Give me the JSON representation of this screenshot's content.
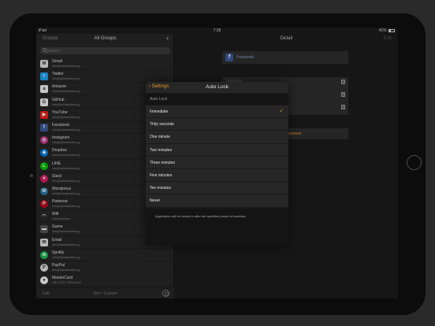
{
  "status_bar": {
    "device": "iPad",
    "time": "7:35",
    "battery": "41%"
  },
  "master": {
    "nav": {
      "left": "Groups",
      "title": "All Groups",
      "add": "+"
    },
    "search": {
      "placeholder": "Search"
    },
    "items": [
      {
        "name": "Gmail",
        "account": "info@kaihatsutetsu.jp",
        "icon": "gmail-icon",
        "color": "#e0e0e0",
        "glyph": "M"
      },
      {
        "name": "Twitter",
        "account": "info@kaihatsutetsu.jp",
        "icon": "twitter-icon",
        "color": "#1da1f2",
        "glyph": "t"
      },
      {
        "name": "Amazon",
        "account": "info@kaihatsutetsu.jp",
        "icon": "amazon-icon",
        "color": "#f2f2f2",
        "glyph": "a"
      },
      {
        "name": "GitHub",
        "account": "info@kaihatsutetsu.jp",
        "icon": "github-icon",
        "color": "#f2f2f2",
        "glyph": "G"
      },
      {
        "name": "YouTube",
        "account": "info@kaihatsutetsu.jp",
        "icon": "youtube-icon",
        "color": "#e62117",
        "glyph": "▶"
      },
      {
        "name": "Facebook",
        "account": "info@kaihatsutetsu.jp",
        "icon": "facebook-icon",
        "color": "#3b5998",
        "glyph": "f"
      },
      {
        "name": "Instagram",
        "account": "info@kaihatsutetsu.jp",
        "icon": "instagram-icon",
        "color": "#c13584",
        "glyph": "◎"
      },
      {
        "name": "Dropbox",
        "account": "info@kaihatsutetsu.jp",
        "icon": "dropbox-icon",
        "color": "#007ee5",
        "glyph": "◆"
      },
      {
        "name": "LINE",
        "account": "info@kaihatsutetsu.jp",
        "icon": "line-icon",
        "color": "#00c300",
        "glyph": "L"
      },
      {
        "name": "Slack",
        "account": "info@kaihatsutetsu.jp",
        "icon": "slack-icon",
        "color": "#d81b60",
        "glyph": "#"
      },
      {
        "name": "Wordpress",
        "account": "info@kaihatsutetsu.jp",
        "icon": "wordpress-icon",
        "color": "#21759b",
        "glyph": "W"
      },
      {
        "name": "Pinterest",
        "account": "info@kaihatsutetsu.jp",
        "icon": "pinterest-icon",
        "color": "#bd081c",
        "glyph": "P"
      },
      {
        "name": "Wifi",
        "account": "Kaihatsutetsu",
        "icon": "wifi-icon",
        "color": "#2a2a2a",
        "glyph": "◠"
      },
      {
        "name": "Game",
        "account": "info@kaihatsutetsu.jp",
        "icon": "game-icon",
        "color": "#555555",
        "glyph": "▬"
      },
      {
        "name": "Email",
        "account": "info@kaihatsutetsu.jp",
        "icon": "email-icon",
        "color": "#e0e0e0",
        "glyph": "✉"
      },
      {
        "name": "Spotify",
        "account": "info@kaihatsutetsu.jp",
        "icon": "spotify-icon",
        "color": "#1db954",
        "glyph": "≋"
      },
      {
        "name": "PayPal",
        "account": "info@kaihatsutetsu.jp",
        "icon": "paypal-icon",
        "color": "#e0e0e0",
        "glyph": "P"
      },
      {
        "name": "MasterCard",
        "account": "1111-2222-3333-4444",
        "icon": "mastercard-icon",
        "color": "#f2f2f2",
        "glyph": "●"
      }
    ],
    "toolbar": {
      "edit": "Edit",
      "sort": "Sort : Custom"
    }
  },
  "detail": {
    "title": "Detail",
    "edit": "Edit",
    "service": "Facebook",
    "field_label": "Username",
    "password_action": "password"
  },
  "modal": {
    "back": "Settings",
    "title": "Auto Lock",
    "section": "Auto Lock",
    "options": [
      {
        "label": "Immediate",
        "selected": true
      },
      {
        "label": "Thity seconds",
        "selected": false
      },
      {
        "label": "One minute",
        "selected": false
      },
      {
        "label": "Two minutes",
        "selected": false
      },
      {
        "label": "Three minutes",
        "selected": false
      },
      {
        "label": "Five minutes",
        "selected": false
      },
      {
        "label": "Ten minutes",
        "selected": false
      },
      {
        "label": "Never",
        "selected": false
      }
    ],
    "footer": "Application will be locked in after the specified period of inactivity.",
    "accent": "#e89a2a"
  }
}
